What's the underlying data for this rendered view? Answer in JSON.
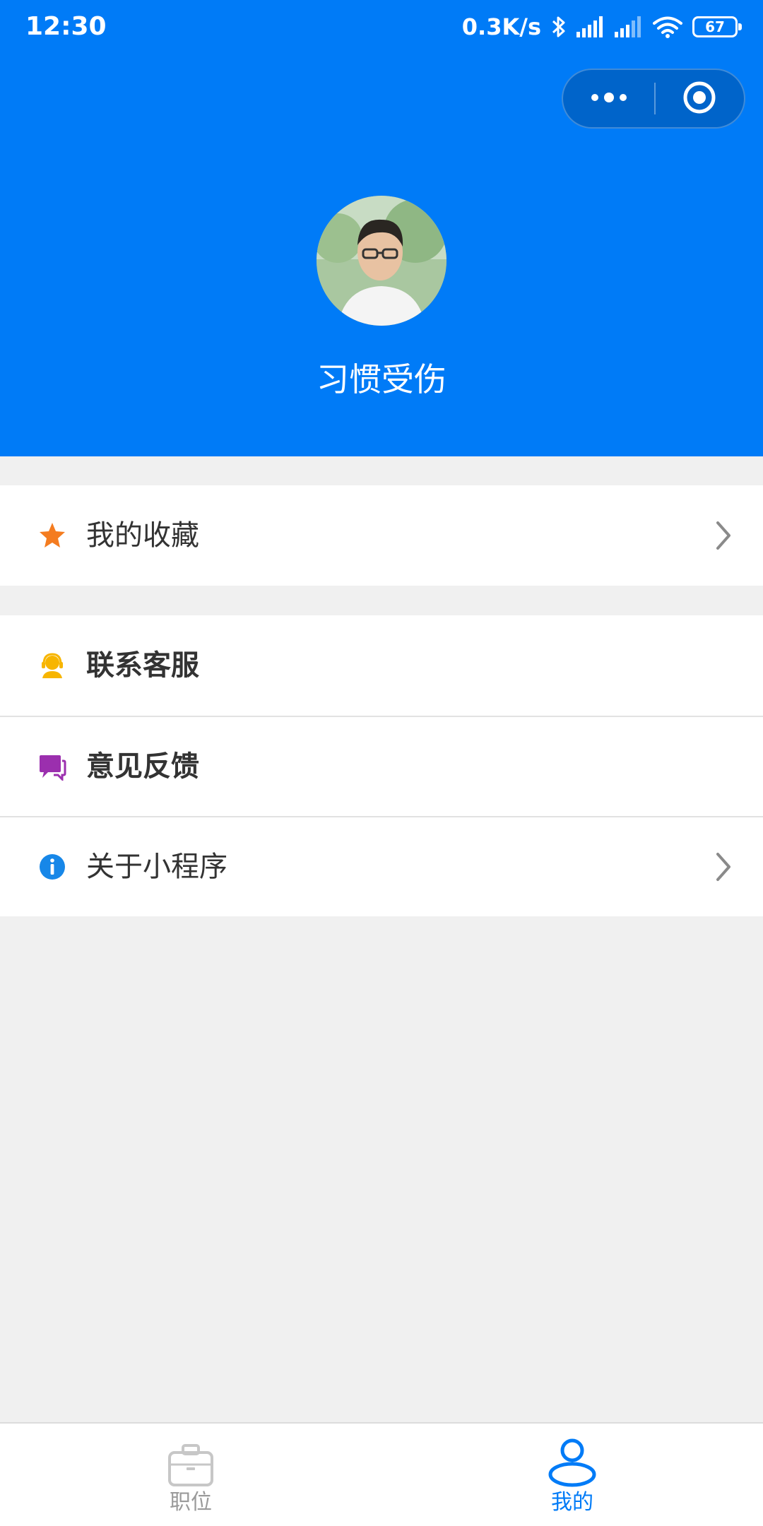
{
  "status_bar": {
    "time": "12:30",
    "net_speed": "0.3K/s",
    "battery_level": "67"
  },
  "capsule": {
    "menu_icon": "more-dots-icon",
    "close_icon": "target-circle-icon"
  },
  "profile": {
    "username": "习惯受伤"
  },
  "menu_groups": [
    {
      "items": [
        {
          "label": "我的收藏",
          "icon": "star-icon",
          "icon_color": "#f47c20",
          "chevron": true
        }
      ]
    },
    {
      "items": [
        {
          "label": "联系客服",
          "icon": "customer-service-icon",
          "icon_color": "#f7b500",
          "chevron": false
        },
        {
          "label": "意见反馈",
          "icon": "feedback-chat-icon",
          "icon_color": "#9b2fae",
          "chevron": false
        },
        {
          "label": "关于小程序",
          "icon": "info-icon",
          "icon_color": "#1787e8",
          "chevron": true
        }
      ]
    }
  ],
  "tabbar": {
    "tabs": [
      {
        "label": "职位",
        "icon": "briefcase-icon",
        "active": false
      },
      {
        "label": "我的",
        "icon": "person-icon",
        "active": true
      }
    ]
  },
  "colors": {
    "primary": "#007bf7",
    "background": "#f0f0f0",
    "inactive_tab": "#9a9a9a"
  }
}
